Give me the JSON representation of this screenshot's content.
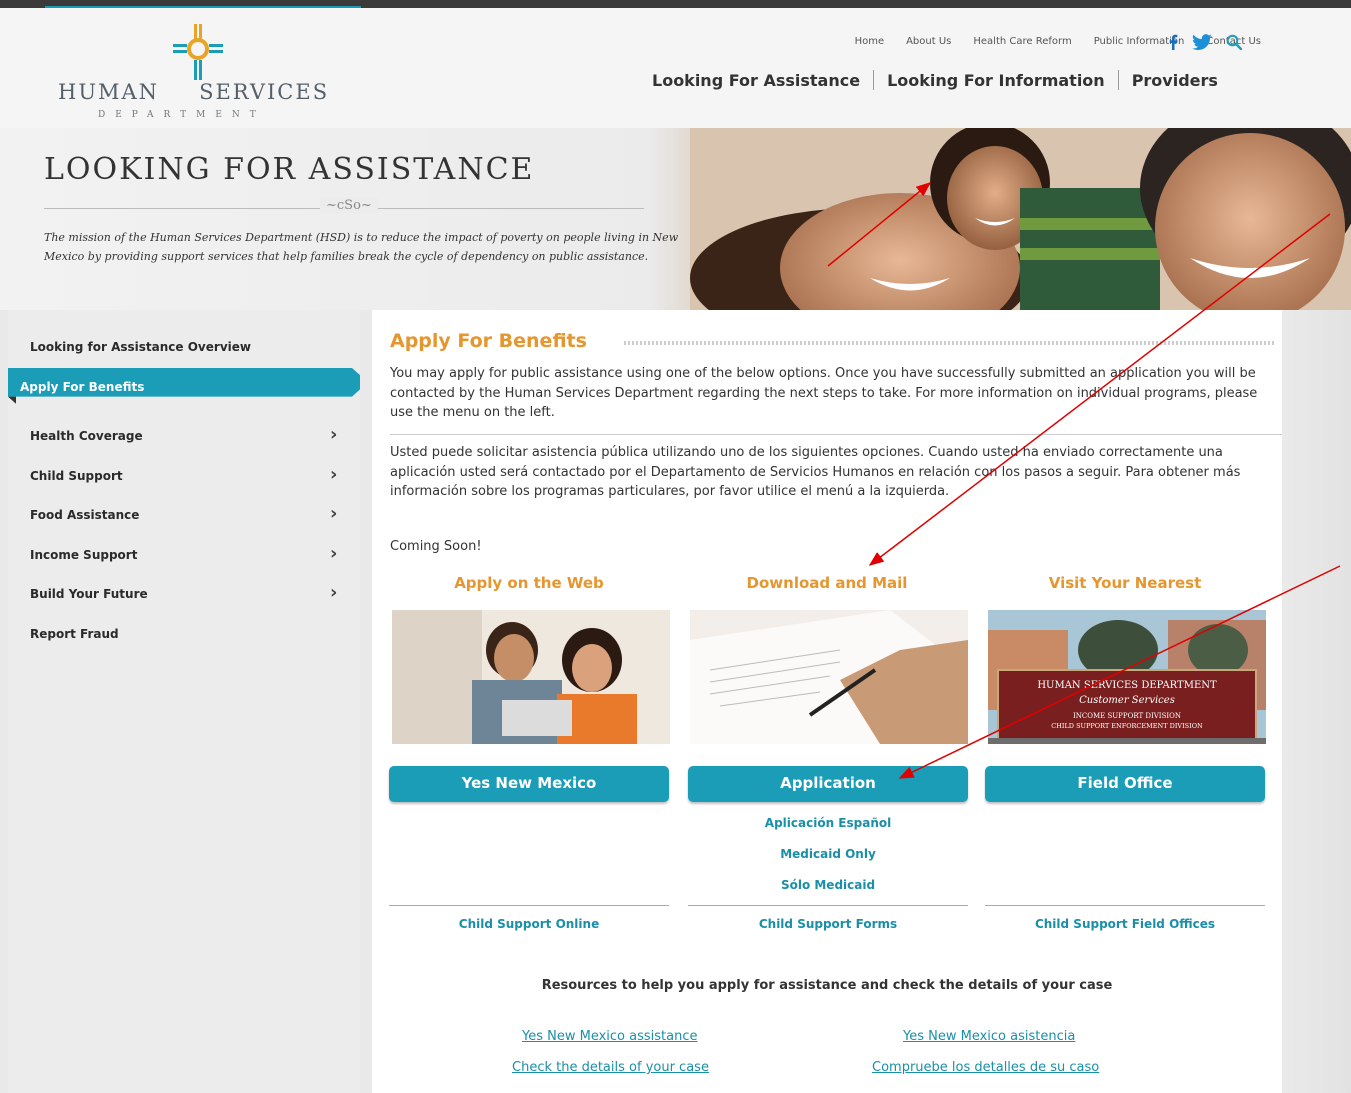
{
  "header": {
    "logo_left": "HUMAN",
    "logo_right": "SERVICES",
    "logo_sub": "DEPARTMENT",
    "util_nav": [
      "Home",
      "About Us",
      "Health Care Reform",
      "Public Information",
      "Contact Us"
    ],
    "main_nav": [
      "Looking For Assistance",
      "Looking For Information",
      "Providers"
    ]
  },
  "hero": {
    "title": "LOOKING FOR ASSISTANCE",
    "flourish": "~cSo~",
    "mission": "The mission of the Human Services Department (HSD) is to reduce the impact of poverty on people living in New Mexico by providing support services that help families break the cycle of dependency on public assistance."
  },
  "sidebar": {
    "items": [
      {
        "label": "Looking for Assistance Overview"
      },
      {
        "label": "Apply For Benefits"
      },
      {
        "label": "Health Coverage"
      },
      {
        "label": "Child Support"
      },
      {
        "label": "Food Assistance"
      },
      {
        "label": "Income Support"
      },
      {
        "label": "Build Your Future"
      },
      {
        "label": "Report Fraud"
      }
    ]
  },
  "content": {
    "title": "Apply For Benefits",
    "para_en": "You may apply for public assistance using one of the below options. Once you have successfully submitted an application you will be contacted by the Human Services Department regarding the next steps to take. For more information on individual programs, please use the menu on the left.",
    "para_es": "Usted puede solicitar asistencia pública utilizando uno de los siguientes opciones. Cuando usted ha enviado correctamente una aplicación usted será contactado por el Departamento de Servicios Humanos en relación con los pasos a seguir. Para obtener más información sobre los programas particulares, por favor utilice el menú a la izquierda.",
    "coming_soon": "Coming Soon!",
    "columns": [
      {
        "heading": "Apply on the Web",
        "button": "Yes New Mexico",
        "bottom_link": "Child Support Online"
      },
      {
        "heading": "Download and Mail",
        "button": "Application",
        "sub_links": [
          "Aplicación Español",
          "Medicaid Only",
          "Sólo Medicaid"
        ],
        "bottom_link": "Child Support Forms"
      },
      {
        "heading": "Visit Your Nearest",
        "button": "Field Office",
        "bottom_link": "Child Support Field Offices"
      }
    ],
    "office_sign": {
      "line1": "HUMAN SERVICES DEPARTMENT",
      "line2": "Customer Services",
      "line3": "INCOME SUPPORT DIVISION",
      "line4": "CHILD SUPPORT ENFORCEMENT DIVISION"
    },
    "resources_heading": "Resources to help you apply for assistance and check the details of your case",
    "resource_links": [
      "Yes New Mexico assistance",
      "Yes New Mexico asistencia",
      "Check the details of your case",
      "Compruebe los detalles de su caso"
    ]
  },
  "colors": {
    "accent": "#1b9cb7",
    "heading_orange": "#e5962f",
    "link": "#1a8fa8",
    "annotation_arrow": "#e00000"
  }
}
